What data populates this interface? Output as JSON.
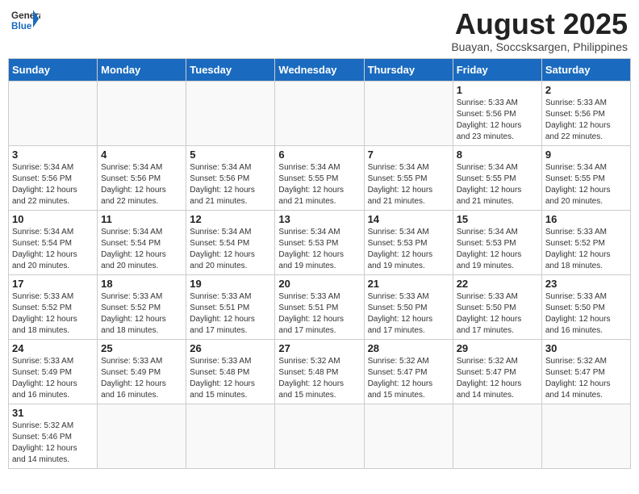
{
  "header": {
    "logo_general": "General",
    "logo_blue": "Blue",
    "month_title": "August 2025",
    "location": "Buayan, Soccsksargen, Philippines"
  },
  "days_of_week": [
    "Sunday",
    "Monday",
    "Tuesday",
    "Wednesday",
    "Thursday",
    "Friday",
    "Saturday"
  ],
  "weeks": [
    {
      "days": [
        {
          "num": "",
          "info": ""
        },
        {
          "num": "",
          "info": ""
        },
        {
          "num": "",
          "info": ""
        },
        {
          "num": "",
          "info": ""
        },
        {
          "num": "",
          "info": ""
        },
        {
          "num": "1",
          "info": "Sunrise: 5:33 AM\nSunset: 5:56 PM\nDaylight: 12 hours\nand 23 minutes."
        },
        {
          "num": "2",
          "info": "Sunrise: 5:33 AM\nSunset: 5:56 PM\nDaylight: 12 hours\nand 22 minutes."
        }
      ]
    },
    {
      "days": [
        {
          "num": "3",
          "info": "Sunrise: 5:34 AM\nSunset: 5:56 PM\nDaylight: 12 hours\nand 22 minutes."
        },
        {
          "num": "4",
          "info": "Sunrise: 5:34 AM\nSunset: 5:56 PM\nDaylight: 12 hours\nand 22 minutes."
        },
        {
          "num": "5",
          "info": "Sunrise: 5:34 AM\nSunset: 5:56 PM\nDaylight: 12 hours\nand 21 minutes."
        },
        {
          "num": "6",
          "info": "Sunrise: 5:34 AM\nSunset: 5:55 PM\nDaylight: 12 hours\nand 21 minutes."
        },
        {
          "num": "7",
          "info": "Sunrise: 5:34 AM\nSunset: 5:55 PM\nDaylight: 12 hours\nand 21 minutes."
        },
        {
          "num": "8",
          "info": "Sunrise: 5:34 AM\nSunset: 5:55 PM\nDaylight: 12 hours\nand 21 minutes."
        },
        {
          "num": "9",
          "info": "Sunrise: 5:34 AM\nSunset: 5:55 PM\nDaylight: 12 hours\nand 20 minutes."
        }
      ]
    },
    {
      "days": [
        {
          "num": "10",
          "info": "Sunrise: 5:34 AM\nSunset: 5:54 PM\nDaylight: 12 hours\nand 20 minutes."
        },
        {
          "num": "11",
          "info": "Sunrise: 5:34 AM\nSunset: 5:54 PM\nDaylight: 12 hours\nand 20 minutes."
        },
        {
          "num": "12",
          "info": "Sunrise: 5:34 AM\nSunset: 5:54 PM\nDaylight: 12 hours\nand 20 minutes."
        },
        {
          "num": "13",
          "info": "Sunrise: 5:34 AM\nSunset: 5:53 PM\nDaylight: 12 hours\nand 19 minutes."
        },
        {
          "num": "14",
          "info": "Sunrise: 5:34 AM\nSunset: 5:53 PM\nDaylight: 12 hours\nand 19 minutes."
        },
        {
          "num": "15",
          "info": "Sunrise: 5:34 AM\nSunset: 5:53 PM\nDaylight: 12 hours\nand 19 minutes."
        },
        {
          "num": "16",
          "info": "Sunrise: 5:33 AM\nSunset: 5:52 PM\nDaylight: 12 hours\nand 18 minutes."
        }
      ]
    },
    {
      "days": [
        {
          "num": "17",
          "info": "Sunrise: 5:33 AM\nSunset: 5:52 PM\nDaylight: 12 hours\nand 18 minutes."
        },
        {
          "num": "18",
          "info": "Sunrise: 5:33 AM\nSunset: 5:52 PM\nDaylight: 12 hours\nand 18 minutes."
        },
        {
          "num": "19",
          "info": "Sunrise: 5:33 AM\nSunset: 5:51 PM\nDaylight: 12 hours\nand 17 minutes."
        },
        {
          "num": "20",
          "info": "Sunrise: 5:33 AM\nSunset: 5:51 PM\nDaylight: 12 hours\nand 17 minutes."
        },
        {
          "num": "21",
          "info": "Sunrise: 5:33 AM\nSunset: 5:50 PM\nDaylight: 12 hours\nand 17 minutes."
        },
        {
          "num": "22",
          "info": "Sunrise: 5:33 AM\nSunset: 5:50 PM\nDaylight: 12 hours\nand 17 minutes."
        },
        {
          "num": "23",
          "info": "Sunrise: 5:33 AM\nSunset: 5:50 PM\nDaylight: 12 hours\nand 16 minutes."
        }
      ]
    },
    {
      "days": [
        {
          "num": "24",
          "info": "Sunrise: 5:33 AM\nSunset: 5:49 PM\nDaylight: 12 hours\nand 16 minutes."
        },
        {
          "num": "25",
          "info": "Sunrise: 5:33 AM\nSunset: 5:49 PM\nDaylight: 12 hours\nand 16 minutes."
        },
        {
          "num": "26",
          "info": "Sunrise: 5:33 AM\nSunset: 5:48 PM\nDaylight: 12 hours\nand 15 minutes."
        },
        {
          "num": "27",
          "info": "Sunrise: 5:32 AM\nSunset: 5:48 PM\nDaylight: 12 hours\nand 15 minutes."
        },
        {
          "num": "28",
          "info": "Sunrise: 5:32 AM\nSunset: 5:47 PM\nDaylight: 12 hours\nand 15 minutes."
        },
        {
          "num": "29",
          "info": "Sunrise: 5:32 AM\nSunset: 5:47 PM\nDaylight: 12 hours\nand 14 minutes."
        },
        {
          "num": "30",
          "info": "Sunrise: 5:32 AM\nSunset: 5:47 PM\nDaylight: 12 hours\nand 14 minutes."
        }
      ]
    },
    {
      "days": [
        {
          "num": "31",
          "info": "Sunrise: 5:32 AM\nSunset: 5:46 PM\nDaylight: 12 hours\nand 14 minutes."
        },
        {
          "num": "",
          "info": ""
        },
        {
          "num": "",
          "info": ""
        },
        {
          "num": "",
          "info": ""
        },
        {
          "num": "",
          "info": ""
        },
        {
          "num": "",
          "info": ""
        },
        {
          "num": "",
          "info": ""
        }
      ]
    }
  ]
}
